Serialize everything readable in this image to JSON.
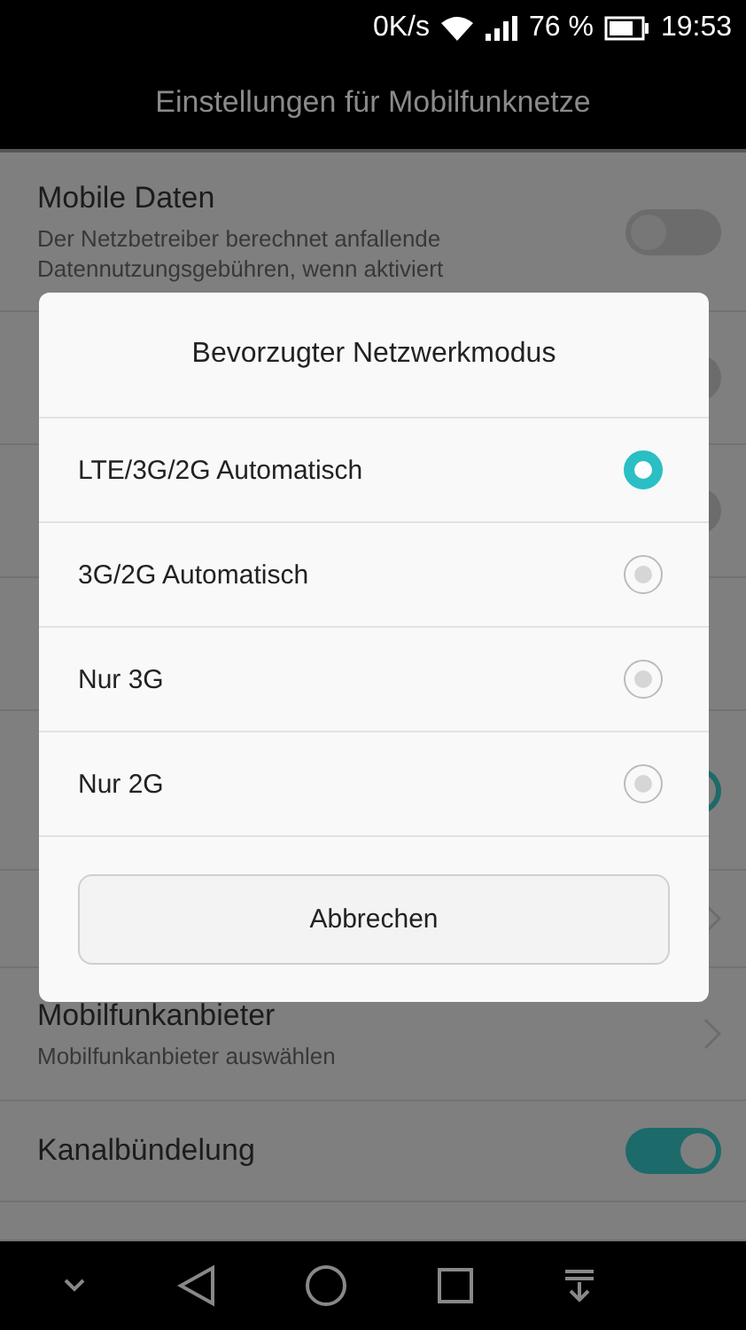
{
  "status_bar": {
    "speed": "0K/s",
    "battery_percent": "76 %",
    "time": "19:53"
  },
  "title": "Einstellungen für Mobilfunknetze",
  "settings": [
    {
      "kind": "toggle",
      "title": "Mobile Daten",
      "subtitle": "Der Netzbetreiber berechnet anfallende Datennutzungsgebühren, wenn aktiviert",
      "on": false
    },
    {
      "kind": "toggle",
      "on": false
    },
    {
      "kind": "toggle",
      "on": false
    },
    {
      "kind": "plain"
    },
    {
      "kind": "toggle",
      "on": true
    },
    {
      "kind": "chevron"
    },
    {
      "kind": "chevron",
      "title": "Mobilfunkanbieter",
      "subtitle": "Mobilfunkanbieter auswählen"
    },
    {
      "kind": "toggle",
      "title": "Kanalbündelung",
      "on": true
    },
    {
      "kind": "plain"
    }
  ],
  "dialog": {
    "title": "Bevorzugter Netzwerkmodus",
    "options": [
      {
        "label": "LTE/3G/2G Automatisch",
        "selected": true
      },
      {
        "label": "3G/2G Automatisch",
        "selected": false
      },
      {
        "label": "Nur 3G",
        "selected": false
      },
      {
        "label": "Nur 2G",
        "selected": false
      }
    ],
    "cancel": "Abbrechen"
  }
}
